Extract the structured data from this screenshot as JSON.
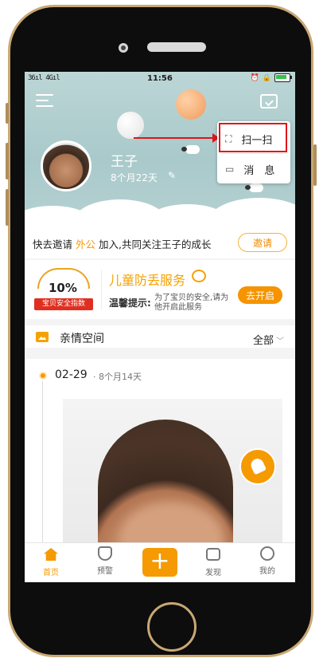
{
  "status_bar": {
    "signal": "36ıl 4Gıl",
    "time": "11:56"
  },
  "hero": {
    "child_name": "王子",
    "child_age": "8个月22天",
    "icons": [
      "menu-icon",
      "message-icon",
      "edit-icon"
    ]
  },
  "popup_menu": {
    "items": [
      {
        "label": "扫一扫",
        "icon": "scan-icon"
      },
      {
        "label": "消　息",
        "icon": "message-bubble-icon"
      }
    ]
  },
  "invite": {
    "text_before": "快去邀请 ",
    "highlight": "外公",
    "text_after": " 加入,共同关注王子的成长",
    "button": "邀请"
  },
  "service": {
    "badge_percent": "10%",
    "badge_label": "宝贝安全指数",
    "title": "儿童防丢服务",
    "tip_label": "温馨提示:",
    "tip_text": "为了宝贝的安全,请为他开启此服务",
    "button": "去开启"
  },
  "family_space": {
    "title": "亲情空间",
    "filter": "全部"
  },
  "post": {
    "date": "02-29",
    "age": "· 8个月14天"
  },
  "tabbar": {
    "tabs": [
      {
        "label": "首页",
        "icon": "home-icon",
        "active": true
      },
      {
        "label": "预警",
        "icon": "alert-icon",
        "active": false
      },
      {
        "label": "",
        "icon": "plus-icon",
        "active": false
      },
      {
        "label": "发现",
        "icon": "discover-icon",
        "active": false
      },
      {
        "label": "我的",
        "icon": "profile-icon",
        "active": false
      }
    ]
  },
  "colors": {
    "accent": "#f59a00",
    "annotation_red": "#e0141c",
    "phone_bezel": "#0d0d0d",
    "phone_trim": "#c9a873"
  }
}
